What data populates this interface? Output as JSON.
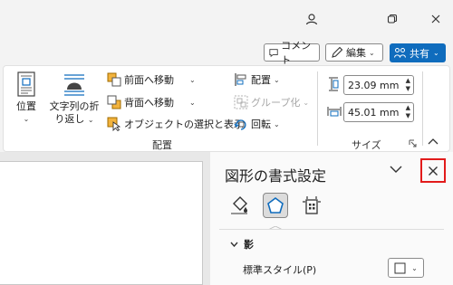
{
  "titlebar": {
    "icons": [
      "person-icon",
      "restore-window-icon",
      "close-window-icon"
    ]
  },
  "commands": {
    "comment_label": "コメント",
    "edit_label": "編集",
    "share_label": "共有"
  },
  "ribbon": {
    "position_label": "位置",
    "wrap_text_line1": "文字列の折",
    "wrap_text_line2": "り返し",
    "bring_forward": "前面へ移動",
    "send_backward": "背面へ移動",
    "selection_pane": "オブジェクトの選択と表示",
    "align": "配置",
    "group": "グループ化",
    "rotate": "回転",
    "arrange_group_label": "配置",
    "height_value": "23.09 mm",
    "width_value": "45.01 mm",
    "size_group_label": "サイズ"
  },
  "pane": {
    "title": "図形の書式設定",
    "tabs": [
      "fill-line-icon",
      "effects-pentagon-icon",
      "size-properties-icon"
    ],
    "active_tab": 1,
    "section_label": "影",
    "preset_label": "標準スタイル(P)",
    "accent_color": "#0f6cbd",
    "highlight_color": "#e21b1b"
  }
}
